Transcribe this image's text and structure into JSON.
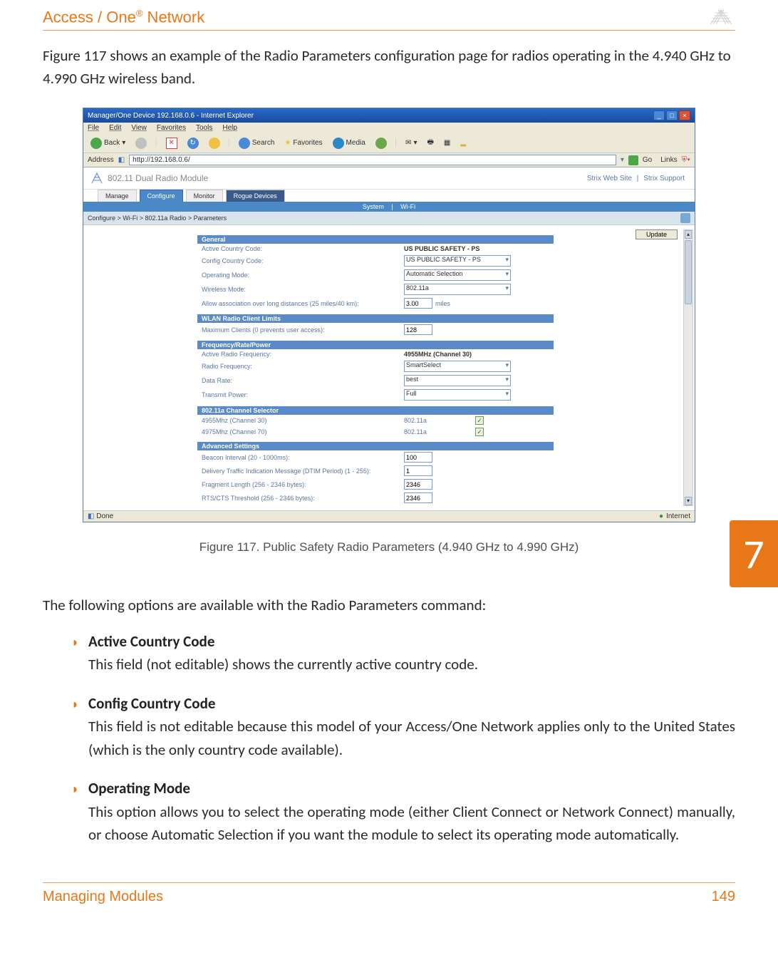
{
  "header": {
    "title_pre": "Access / One",
    "title_sup": "®",
    "title_post": " Network"
  },
  "intro": "Figure 117 shows an example of the Radio Parameters configuration page for radios operating in the 4.940 GHz to 4.990 GHz wireless band.",
  "screenshot": {
    "window_title": "Manager/One Device 192.168.0.6 - Internet Explorer",
    "menus": {
      "file": "File",
      "edit": "Edit",
      "view": "View",
      "favorites": "Favorites",
      "tools": "Tools",
      "help": "Help"
    },
    "toolbar": {
      "back": "Back",
      "search": "Search",
      "favorites": "Favorites",
      "media": "Media"
    },
    "address_label": "Address",
    "address_value": "http://192.168.0.6/",
    "go": "Go",
    "links": "Links",
    "app_title": "802.11 Dual Radio Module",
    "top_links": {
      "web": "Strix Web Site",
      "support": "Strix Support"
    },
    "tabs": {
      "manage": "Manage",
      "configure": "Configure",
      "monitor": "Monitor",
      "rogue": "Rogue Devices"
    },
    "subtabs": {
      "system": "System",
      "wifi": "Wi-Fi"
    },
    "breadcrumb": "Configure > Wi-Fi > 802.11a Radio > Parameters",
    "update": "Update",
    "sections": {
      "general": {
        "title": "General",
        "active_country_label": "Active Country Code:",
        "active_country_value": "US PUBLIC SAFETY - PS",
        "config_country_label": "Config Country Code:",
        "config_country_value": "US PUBLIC SAFETY - PS",
        "op_mode_label": "Operating Mode:",
        "op_mode_value": "Automatic Selection",
        "wireless_mode_label": "Wireless Mode:",
        "wireless_mode_value": "802.11a",
        "long_assoc_label": "Allow association over long distances (25 miles/40 km):",
        "long_assoc_value": "3.00",
        "long_assoc_unit": "miles"
      },
      "wlan": {
        "title": "WLAN Radio Client Limits",
        "max_clients_label": "Maximum Clients (0 prevents user access):",
        "max_clients_value": "128"
      },
      "freq": {
        "title": "Frequency/Rate/Power",
        "active_freq_label": "Active Radio Frequency:",
        "active_freq_value": "4955MHz (Channel 30)",
        "radio_freq_label": "Radio Frequency:",
        "radio_freq_value": "SmartSelect",
        "data_rate_label": "Data Rate:",
        "data_rate_value": "best",
        "tx_power_label": "Transmit Power:",
        "tx_power_value": "Full"
      },
      "chan": {
        "title": "802.11a Channel Selector",
        "ch30_label": "4955Mhz (Channel 30)",
        "ch30_mode": "802.11a",
        "ch70_label": "4975Mhz (Channel 70)",
        "ch70_mode": "802.11a"
      },
      "adv": {
        "title": "Advanced Settings",
        "beacon_label": "Beacon Interval (20 - 1000ms):",
        "beacon_value": "100",
        "dtim_label": "Delivery Traffic Indication Message (DTIM Period) (1 - 255):",
        "dtim_value": "1",
        "frag_label": "Fragment Length (256 - 2346 bytes):",
        "frag_value": "2346",
        "rts_label": "RTS/CTS Threshold (256 - 2346 bytes):",
        "rts_value": "2346"
      }
    },
    "status_left": "Done",
    "status_right": "Internet"
  },
  "figure_caption": "Figure 117. Public Safety Radio Parameters (4.940 GHz to 4.990 GHz)",
  "chapter": "7",
  "options_intro": "The following options are available with the Radio Parameters command:",
  "options": {
    "o1_title": "Active Country Code",
    "o1_body": "This field (not editable) shows the currently active country code.",
    "o2_title": "Config Country Code",
    "o2_body": "This field is not editable because this model of your Access/One Network applies only to the United States (which is the only country code available).",
    "o3_title": "Operating Mode",
    "o3_body": "This option allows you to select the operating mode (either Client Connect or Network Connect) manually, or choose Automatic Selection if you want the module to select its operating mode automatically."
  },
  "footer": {
    "section": "Managing Modules",
    "page": "149"
  }
}
